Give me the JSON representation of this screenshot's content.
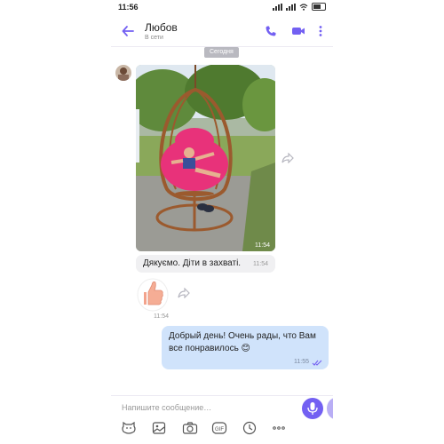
{
  "status_bar": {
    "time": "11:56"
  },
  "header": {
    "contact_name": "Любов",
    "contact_status": "В сети"
  },
  "date_badge": "Сегодня",
  "messages": {
    "photo": {
      "time": "11:54"
    },
    "text_in": {
      "text": "Дякуємо. Діти в захваті.",
      "time": "11:54"
    },
    "sticker": {
      "time": "11:54",
      "icon": "thumbs-up-sticker"
    },
    "text_out": {
      "text": "Добрый день! Очень рады, что Вам все понравилось 😊",
      "time": "11:55",
      "status": "read"
    }
  },
  "composer": {
    "placeholder": "Напишите сообщение…"
  },
  "colors": {
    "accent": "#7360f2",
    "outgoing_bubble": "#d0e3fb",
    "incoming_bubble": "#f0f0f2"
  },
  "toolbar_icons": [
    "sticker-icon",
    "gallery-icon",
    "camera-icon",
    "gif-icon",
    "clock-icon",
    "more-icon"
  ]
}
